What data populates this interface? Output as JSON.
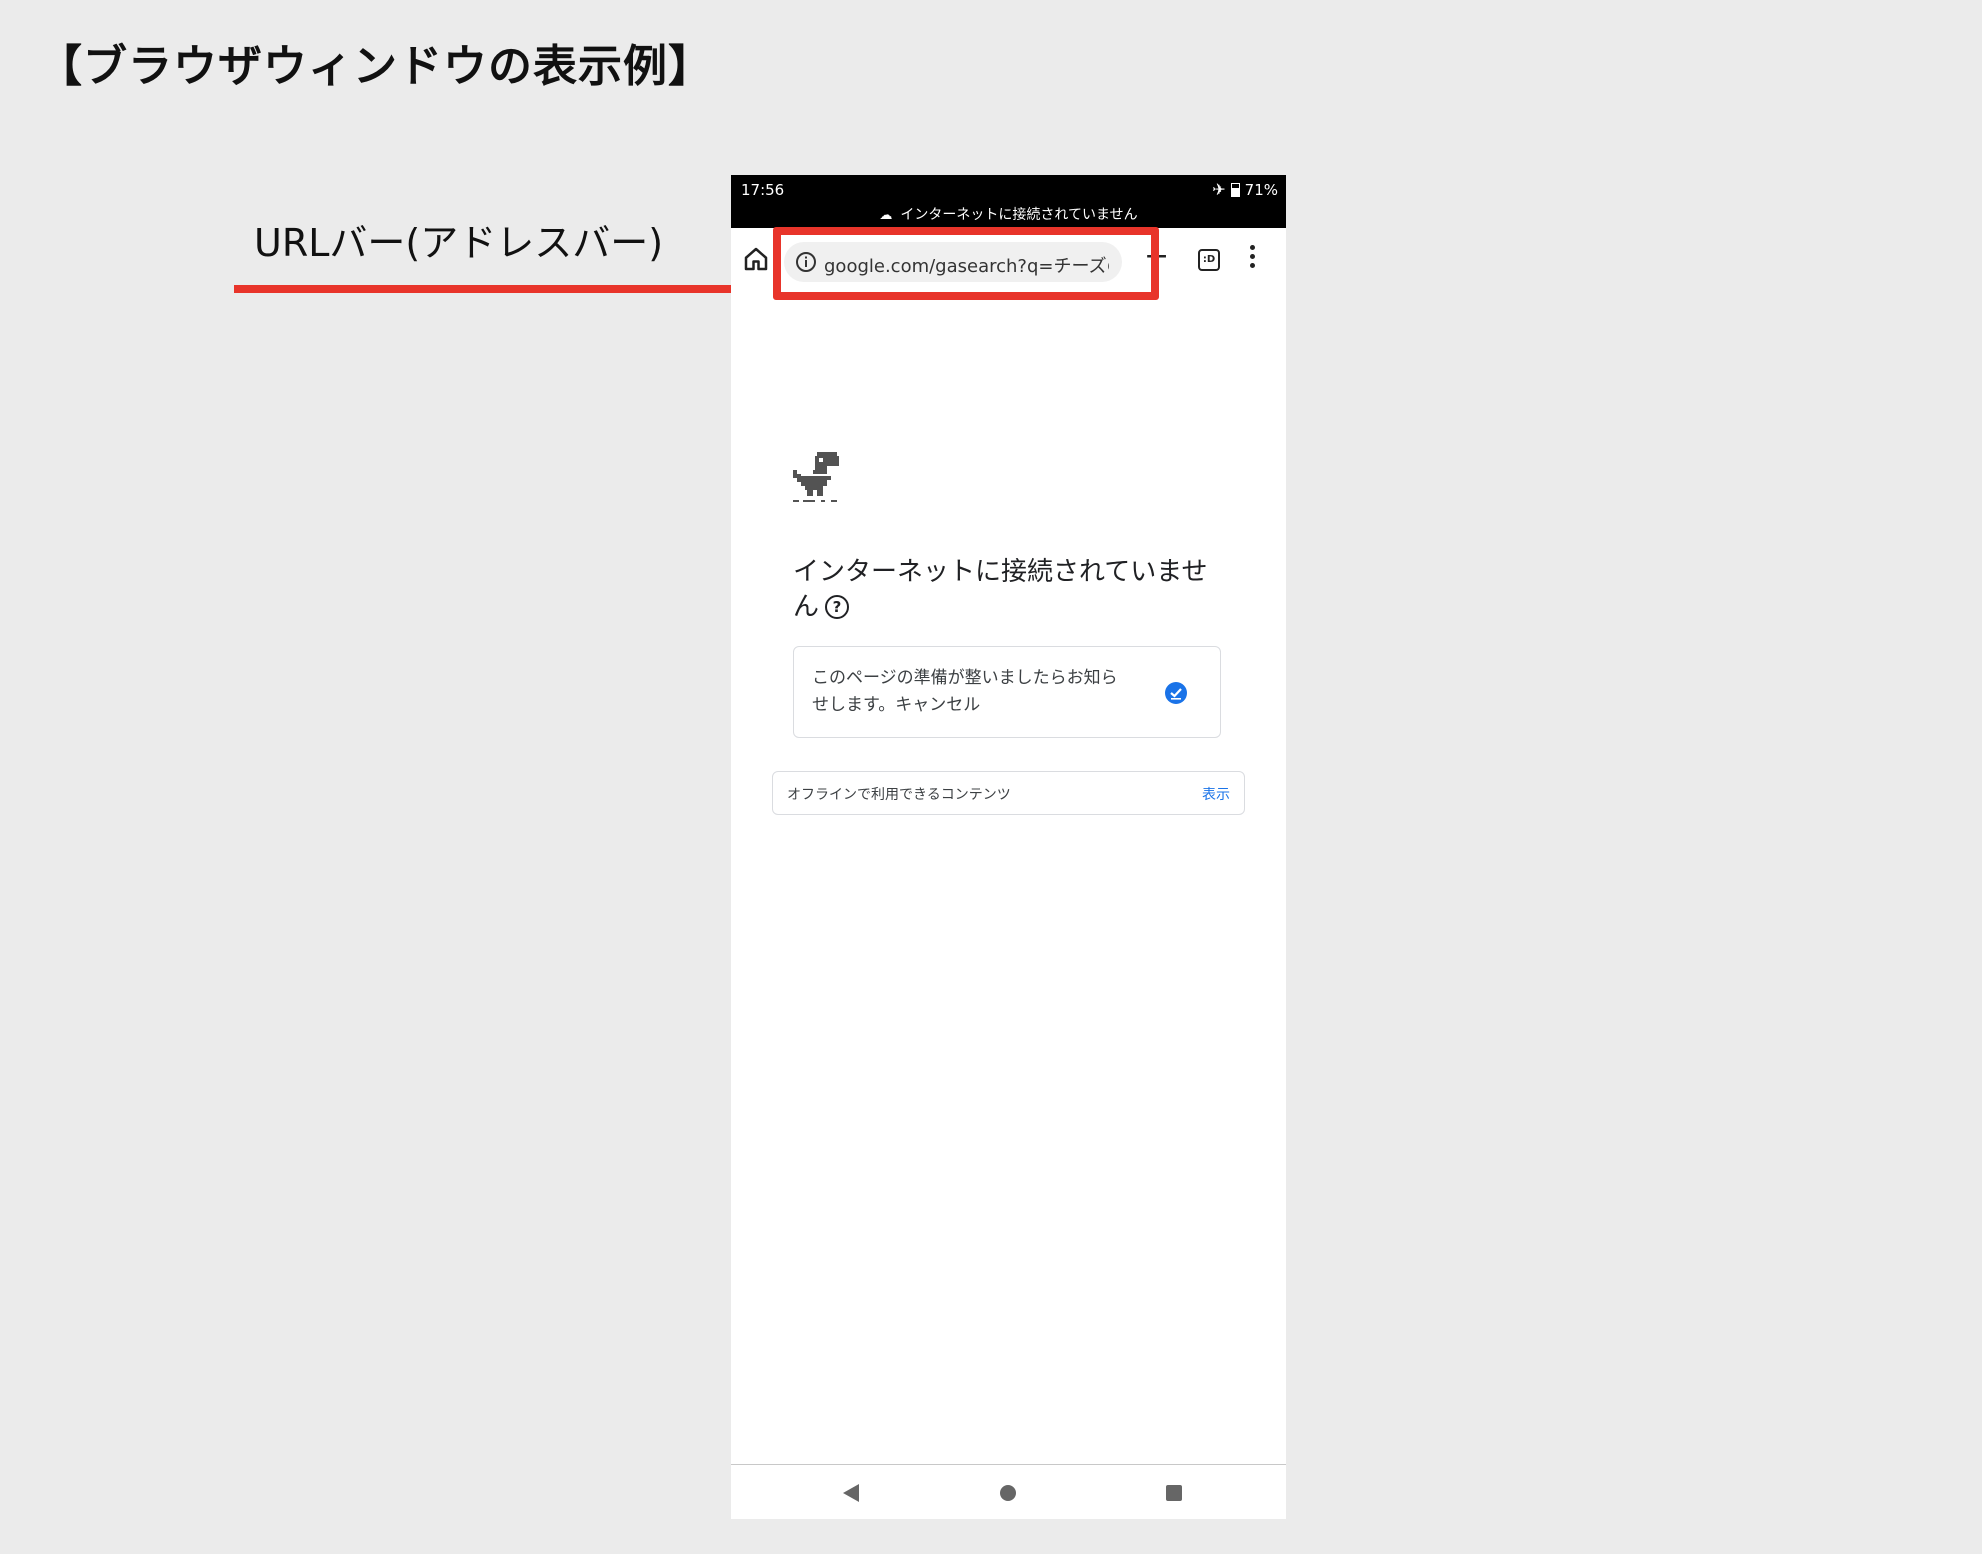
{
  "page_title": "【ブラウザウィンドウの表示例】",
  "annotation": {
    "label": "URLバー(アドレスバー)",
    "color": "#e8342a"
  },
  "status_bar": {
    "time": "17:56",
    "battery": "71%",
    "offline_banner": "インターネットに接続されていません"
  },
  "toolbar": {
    "url": "google.com/gasearch?q=チーズの作り方",
    "icons": [
      "home-icon",
      "info-icon",
      "plus-icon",
      "tab-switcher-icon",
      "more-vert-icon"
    ],
    "tabs_symbol": ":D"
  },
  "content": {
    "error_title": "インターネットに接続されていません",
    "notify_text": "このページの準備が整いましたらお知らせします。キャンセル",
    "offline_label": "オフラインで利用できるコンテンツ",
    "offline_show": "表示"
  },
  "colors": {
    "accent": "#1a73e8",
    "background": "#ebebeb"
  }
}
